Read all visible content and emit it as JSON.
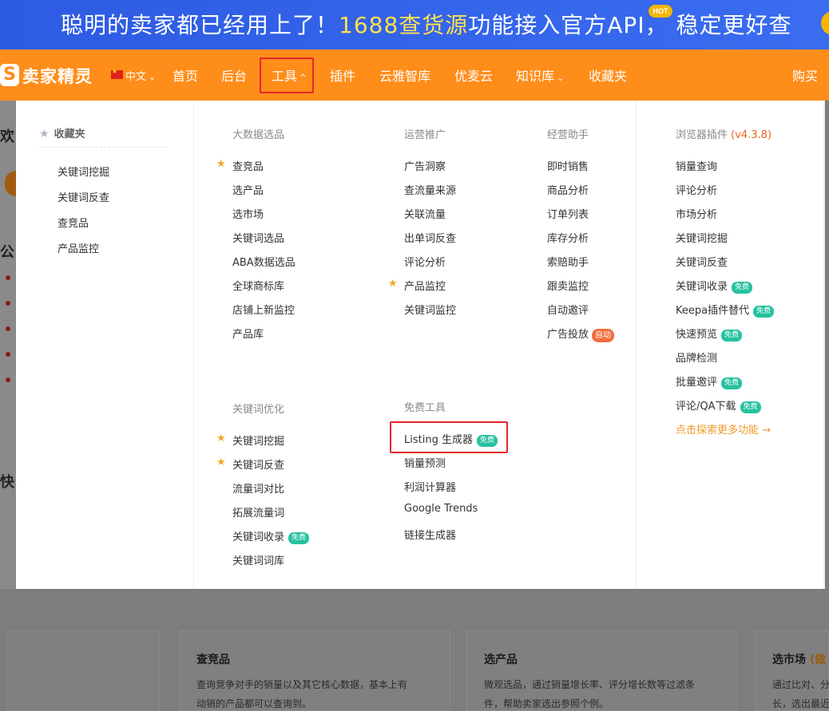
{
  "banner": {
    "text_before": "聪明的卖家都已经用上了！",
    "text_highlight": "1688查货源",
    "text_after": "功能接入官方API，",
    "text_end": "稳定更好查",
    "hot_badge": "HOT",
    "colors": {
      "background": "#2d5be3",
      "highlight": "#ffe14d"
    }
  },
  "navbar": {
    "logo_mark": "S",
    "logo_text": "卖家精灵",
    "lang": "中文",
    "items": [
      "首页",
      "后台",
      "工具",
      "插件",
      "云雅智库",
      "优麦云",
      "知识库",
      "收藏夹"
    ],
    "buy_label": "购买",
    "active_item": "工具",
    "colors": {
      "background": "#ff8d1a",
      "highlight_box": "#e6262b"
    }
  },
  "favorites": {
    "title": "收藏夹",
    "items": [
      "关键词挖掘",
      "关键词反查",
      "查竞品",
      "产品监控"
    ]
  },
  "sections": {
    "big_data": {
      "title": "大数据选品",
      "items": [
        "查竞品",
        "选产品",
        "选市场",
        "关键词选品",
        "ABA数据选品",
        "全球商标库",
        "店铺上新监控",
        "产品库"
      ]
    },
    "ops": {
      "title": "运营推广",
      "items": [
        "广告洞察",
        "查流量来源",
        "关联流量",
        "出单词反查",
        "评论分析",
        "产品监控",
        "关键词监控"
      ]
    },
    "assistant": {
      "title": "经营助手",
      "items": [
        "即时销售",
        "商品分析",
        "订单列表",
        "库存分析",
        "索赔助手",
        "跟卖监控",
        "自动邀评",
        "广告投放"
      ],
      "auto_badge": "自动"
    },
    "plugin": {
      "title": "浏览器插件",
      "version": "(v4.3.8)",
      "items": [
        "销量查询",
        "评论分析",
        "市场分析",
        "关键词挖掘",
        "关键词反查",
        "关键词收录",
        "Keepa插件替代",
        "快速预览",
        "品牌检测",
        "批量邀评",
        "评论/QA下载"
      ],
      "explore_link": "点击探索更多功能 →"
    },
    "keyword_opt": {
      "title": "关键词优化",
      "items": [
        "关键词挖掘",
        "关键词反查",
        "流量词对比",
        "拓展流量词",
        "关键词收录",
        "关键词词库"
      ]
    },
    "free_tools": {
      "title": "免费工具",
      "items": [
        "Listing 生成器",
        "销量预测",
        "利润计算器",
        "Google Trends",
        "链接生成器"
      ]
    },
    "free_badge": "免费",
    "colors": {
      "star": "#f5a623",
      "free_badge": "#27c2a0",
      "auto_badge": "#f36e3d",
      "version": "#e8641a"
    }
  },
  "background": {
    "side_letters": [
      "欢",
      "公",
      "快"
    ],
    "cards": [
      {
        "title": "查竞品",
        "desc1": "查询竞争对手的销量以及其它核心数据，基本上有",
        "desc2": "动销的产品都可以查询到。"
      },
      {
        "title": "选产品",
        "desc1": "微观选品，通过销量增长率、评分增长数等过滤条",
        "desc2": "件，帮助卖家选出参照个例。"
      },
      {
        "title": "选市场",
        "title_tag": "(做",
        "desc1": "通过比对、分",
        "desc2": "长，选出最近"
      }
    ]
  }
}
